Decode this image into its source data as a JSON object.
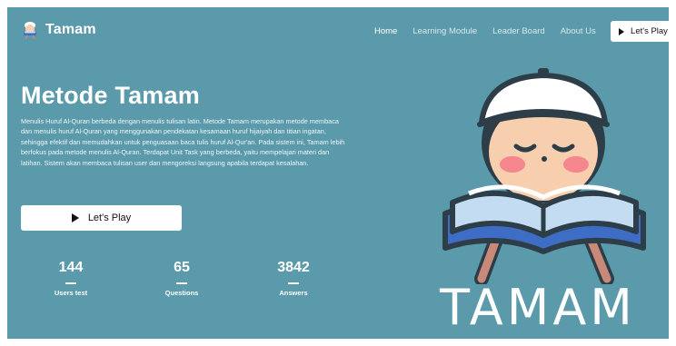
{
  "brand": {
    "name": "Tamam",
    "logo_icon": "boy-reading-logo-icon"
  },
  "nav": {
    "links": [
      {
        "label": "Home",
        "active": true
      },
      {
        "label": "Learning Module",
        "active": false
      },
      {
        "label": "Leader Board",
        "active": false
      },
      {
        "label": "About Us",
        "active": false
      }
    ],
    "cta_label": "Let's Play",
    "cta_icon": "play-icon"
  },
  "hero": {
    "title": "Metode Tamam",
    "description": "Menulis Huruf Al-Quran berbeda dengan menulis tulisan latin. Metode Tamam merupakan metode membaca dan menulis huruf Al-Quran yang menggunakan pendekatan kesamaan huruf hijaiyah dan titian ingatan, sehingga efektif dan memudahkan untuk penguasaan baca tulis huruf Al-Qur'an. Pada sistem ini, Tamam lebih berfokus pada metode menulis Al-Quran. Terdapat Unit Task yang berbeda, yaitu mempelajari materi dan latihan. Sistem akan membaca tulisan user dan mengoreksi langsung apabila terdapat kesalahan.",
    "cta_label": "Let's Play",
    "cta_icon": "play-icon"
  },
  "stats": [
    {
      "value": "144",
      "label": "Users test"
    },
    {
      "value": "65",
      "label": "Questions"
    },
    {
      "value": "3842",
      "label": "Answers"
    }
  ],
  "illustration": {
    "icon": "boy-reading-quran-icon",
    "wordmark": "TAMAM"
  },
  "colors": {
    "background": "#5a9aaa",
    "text": "#ffffff",
    "button_bg": "#ffffff",
    "cap": "#ffffff",
    "skin": "#f8cfae",
    "hair": "#2e3e48",
    "cheek": "#f5868e",
    "book_light": "#c4dcf1",
    "book_dark": "#3d6dc4",
    "stand": "#c98979"
  }
}
